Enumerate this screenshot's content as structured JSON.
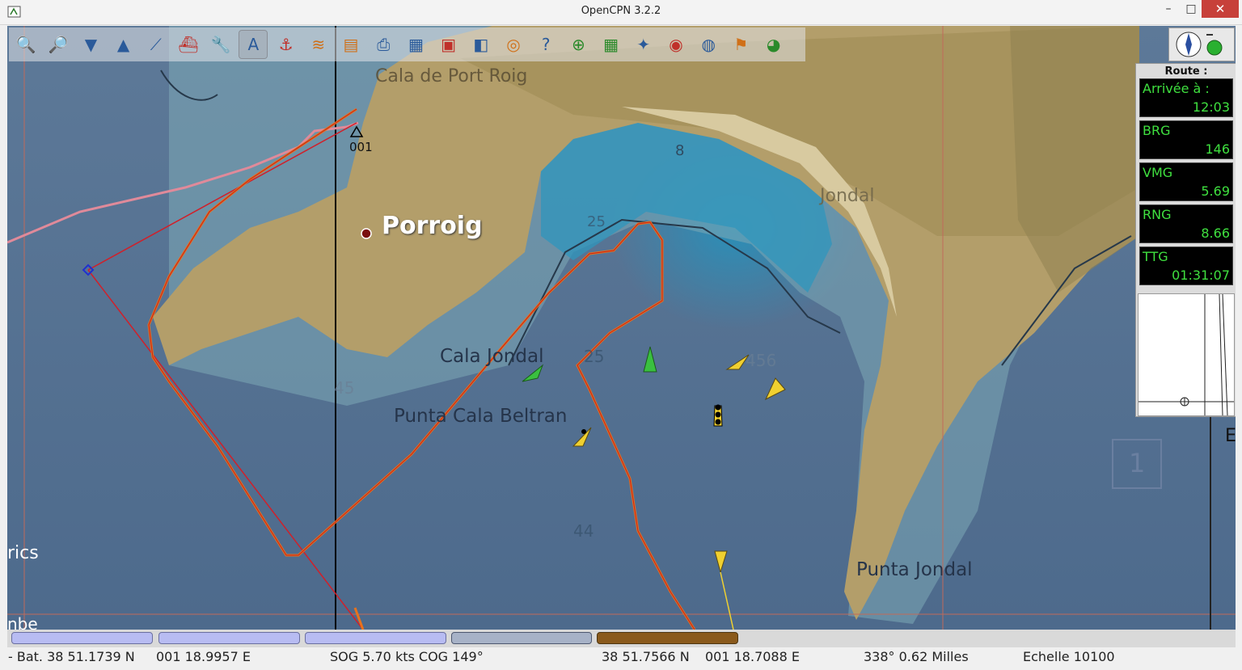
{
  "window": {
    "title": "OpenCPN 3.2.2"
  },
  "toolbar": {
    "tools": [
      {
        "name": "zoom-in-tool",
        "glyph": "🔍"
      },
      {
        "name": "zoom-out-tool",
        "glyph": "🔎"
      },
      {
        "name": "scale-in-tool",
        "glyph": "▼"
      },
      {
        "name": "scale-out-tool",
        "glyph": "▲"
      },
      {
        "name": "create-route-tool",
        "glyph": "⟋"
      },
      {
        "name": "auto-follow-tool",
        "glyph": "⛴"
      },
      {
        "name": "options-tool",
        "glyph": "🔧"
      },
      {
        "name": "text-tool",
        "glyph": "A"
      },
      {
        "name": "current-tool",
        "glyph": "⚓"
      },
      {
        "name": "tide-tool",
        "glyph": "≋"
      },
      {
        "name": "chart-quilt-tool",
        "glyph": "▤"
      },
      {
        "name": "print-tool",
        "glyph": "⎙"
      },
      {
        "name": "route-manager-tool",
        "glyph": "▦"
      },
      {
        "name": "track-tool",
        "glyph": "▣"
      },
      {
        "name": "color-scheme-tool",
        "glyph": "◧"
      },
      {
        "name": "mob-tool",
        "glyph": "◎"
      },
      {
        "name": "help-tool",
        "glyph": "?"
      },
      {
        "name": "target-tool",
        "glyph": "⊕"
      },
      {
        "name": "calculator-tool",
        "glyph": "▦"
      },
      {
        "name": "plugin-tool",
        "glyph": "✦"
      },
      {
        "name": "radar-tool",
        "glyph": "◉"
      },
      {
        "name": "sphere-tool",
        "glyph": "◍"
      },
      {
        "name": "route-tool",
        "glyph": "⚑"
      },
      {
        "name": "globe-tool",
        "glyph": "◕"
      }
    ]
  },
  "map_labels": {
    "cala_port_roig": "Cala de Port Roig",
    "porroig": "Porroig",
    "jondal": "Jondal",
    "cala_jondal": "Cala Jondal",
    "punta_cala_beltran": "Punta Cala Beltran",
    "punta_jondal": "Punta Jondal",
    "waypoint": "001",
    "depth_8": "8",
    "depth_25a": "25",
    "depth_25b": "25",
    "depth_45": "45",
    "depth_456": "456",
    "depth_44": "44",
    "edge_left1": "rics",
    "edge_left2": "nbe",
    "edge_right": "E",
    "square_label": "1"
  },
  "dashboard": {
    "title": "Route :",
    "instruments": [
      {
        "label": "Arrivée à :",
        "value": "12:03"
      },
      {
        "label": "BRG",
        "value": "146"
      },
      {
        "label": "VMG",
        "value": "5.69"
      },
      {
        "label": "RNG",
        "value": "8.66"
      },
      {
        "label": "TTG",
        "value": "01:31:07"
      }
    ]
  },
  "piano": {
    "keys": [
      "blue",
      "blue",
      "blue",
      "gray",
      "brown"
    ]
  },
  "status": {
    "boat": "- Bat. 38 51.1739 N",
    "boat_lon": "001 18.9957 E",
    "sog_cog": "SOG 5.70 kts   COG 149°",
    "cursor_lat": "38 51.7566 N",
    "cursor_lon": "001 18.7088 E",
    "bearing_dist": "338°  0.62 Milles",
    "scale": "Echelle 10100"
  },
  "colors": {
    "track": "#e8721c",
    "route": "#d0202a",
    "ais_target": "#f0d030",
    "ais_green": "#3ac040",
    "dashboard_text": "#3fe03f"
  }
}
